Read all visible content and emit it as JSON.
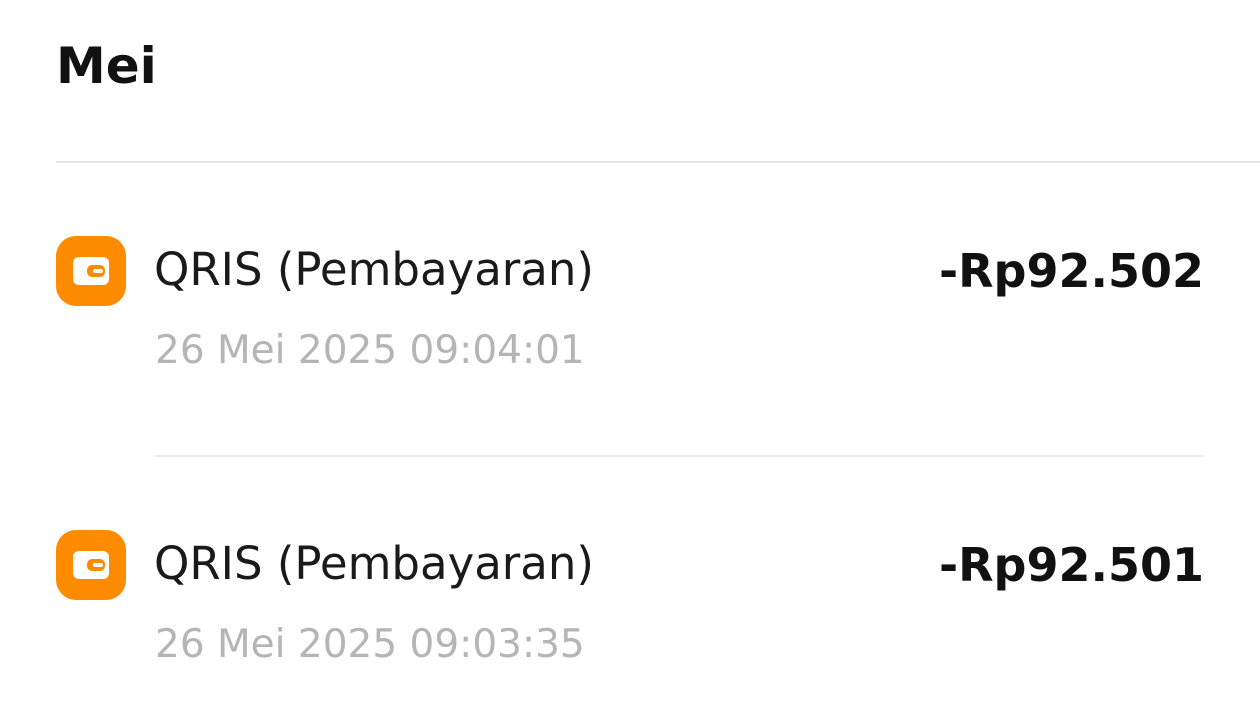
{
  "section": {
    "month": "Mei"
  },
  "transactions": [
    {
      "title": "QRIS (Pembayaran)",
      "datetime": "26 Mei 2025 09:04:01",
      "amount": "-Rp92.502",
      "icon": "wallet-icon"
    },
    {
      "title": "QRIS (Pembayaran)",
      "datetime": "26 Mei 2025 09:03:35",
      "amount": "-Rp92.501",
      "icon": "wallet-icon"
    }
  ],
  "colors": {
    "icon_background": "#ff8c00",
    "icon_foreground": "#ffffff",
    "amount": "#111111",
    "date": "#b5b5b5",
    "divider": "#e6e6e6"
  }
}
